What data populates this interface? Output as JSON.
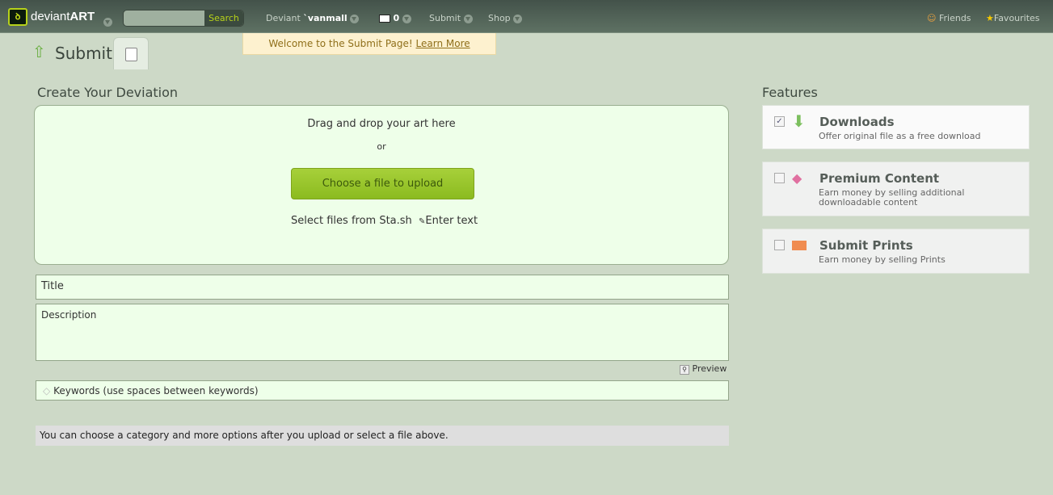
{
  "header": {
    "logo": "deviantART",
    "logo_a": "deviant",
    "logo_b": "ART",
    "search_button": "Search",
    "search_value": "",
    "user_prefix": "Deviant",
    "username": "`vanmall",
    "messages_count": "0",
    "submit": "Submit",
    "shop": "Shop",
    "friends": "Friends",
    "favourites": "Favourites"
  },
  "banner": {
    "text": "Welcome to the Submit Page!",
    "link": "Learn More"
  },
  "page": {
    "title": "Submit"
  },
  "create": {
    "heading": "Create Your Deviation",
    "drag_text": "Drag and drop your art here",
    "or": "or",
    "choose_button": "Choose a file to upload",
    "stash_link": "Select files from Sta.sh",
    "enter_text_link": "Enter text"
  },
  "form": {
    "title_placeholder": "Title",
    "description_placeholder": "Description",
    "preview": "Preview",
    "keywords_placeholder": "Keywords (use spaces between keywords)",
    "info": "You can choose a category and more options after you upload or select a file above."
  },
  "features": {
    "heading": "Features",
    "items": [
      {
        "title": "Downloads",
        "desc": "Offer original file as a free download",
        "checked": true,
        "icon": "download-arrow-icon"
      },
      {
        "title": "Premium Content",
        "desc": "Earn money by selling additional downloadable content",
        "checked": false,
        "icon": "gem-icon"
      },
      {
        "title": "Submit Prints",
        "desc": "Earn money by selling Prints",
        "checked": false,
        "icon": "shopping-bag-icon"
      }
    ]
  }
}
